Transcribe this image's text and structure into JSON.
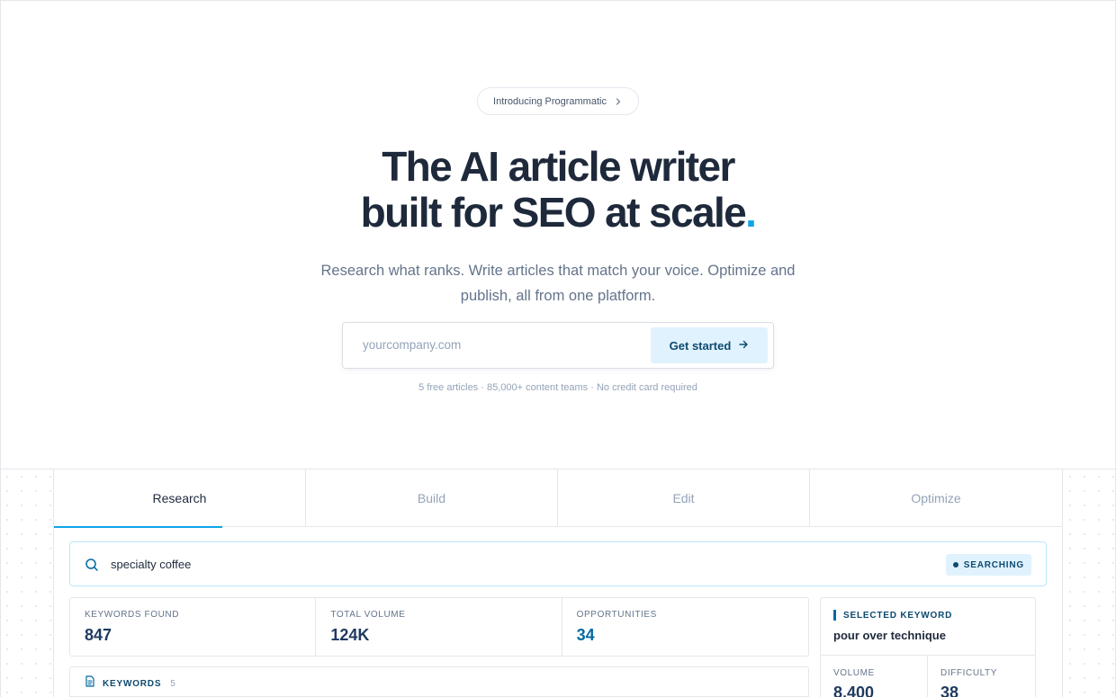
{
  "hero": {
    "announcement": "Introducing Programmatic",
    "headline_line1": "The AI article writer",
    "headline_line2": "built for SEO at scale",
    "headline_dot": ".",
    "subheadline": "Research what ranks. Write articles that match your voice. Optimize and publish, all from one platform.",
    "signup": {
      "placeholder": "yourcompany.com",
      "cta_label": "Get started"
    },
    "meta": "5 free articles · 85,000+ content teams · No credit card required"
  },
  "demo": {
    "tabs": [
      {
        "label": "Research",
        "active": true
      },
      {
        "label": "Build",
        "active": false
      },
      {
        "label": "Edit",
        "active": false
      },
      {
        "label": "Optimize",
        "active": false
      }
    ],
    "search": {
      "query": "specialty coffee",
      "status": "SEARCHING"
    },
    "stats": [
      {
        "label": "KEYWORDS FOUND",
        "value": "847"
      },
      {
        "label": "TOTAL VOLUME",
        "value": "124K"
      },
      {
        "label": "OPPORTUNITIES",
        "value": "34"
      }
    ],
    "keywords_panel": {
      "title": "KEYWORDS",
      "count": "5"
    },
    "selected_keyword": {
      "label": "SELECTED KEYWORD",
      "keyword": "pour over technique",
      "volume_label": "VOLUME",
      "volume": "8,400",
      "difficulty_label": "DIFFICULTY",
      "difficulty": "38"
    }
  },
  "colors": {
    "accent": "#0ea5e9",
    "cta_bg": "#e0f2fe",
    "cta_text": "#0c4a6e",
    "headline": "#1e293b"
  },
  "icons": [
    "chevron-right-icon",
    "arrow-right-icon",
    "search-icon",
    "document-icon"
  ]
}
